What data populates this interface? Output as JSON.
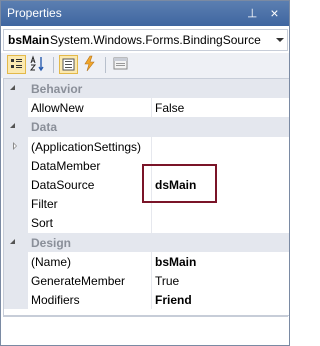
{
  "window": {
    "title": "Properties",
    "pin_glyph": "⊣",
    "close_glyph": "×"
  },
  "object_selector": {
    "name": "bsMain",
    "type": "System.Windows.Forms.BindingSource"
  },
  "toolbar": {
    "buttons": [
      {
        "name": "categorized-icon",
        "pressed": true
      },
      {
        "name": "alphabetical-icon",
        "pressed": false
      },
      {
        "name": "properties-icon",
        "pressed": true
      },
      {
        "name": "events-icon",
        "pressed": false
      },
      {
        "name": "property-pages-icon",
        "pressed": false
      }
    ]
  },
  "grid": {
    "categories": {
      "behavior": "Behavior",
      "data": "Data",
      "design": "Design"
    },
    "rows": {
      "allownew": {
        "name": "AllowNew",
        "value": "False"
      },
      "appsettings": {
        "name": "(ApplicationSettings)",
        "value": ""
      },
      "datamember": {
        "name": "DataMember",
        "value": ""
      },
      "datasource": {
        "name": "DataSource",
        "value": "dsMain"
      },
      "filter": {
        "name": "Filter",
        "value": ""
      },
      "sort": {
        "name": "Sort",
        "value": ""
      },
      "name": {
        "name": "(Name)",
        "value": "bsMain"
      },
      "generatemember": {
        "name": "GenerateMember",
        "value": "True"
      },
      "modifiers": {
        "name": "Modifiers",
        "value": "Friend"
      }
    }
  },
  "colors": {
    "titlebar": "#4a72a9",
    "category_bg": "#e4e7ee",
    "highlight_border": "#7a1428"
  }
}
